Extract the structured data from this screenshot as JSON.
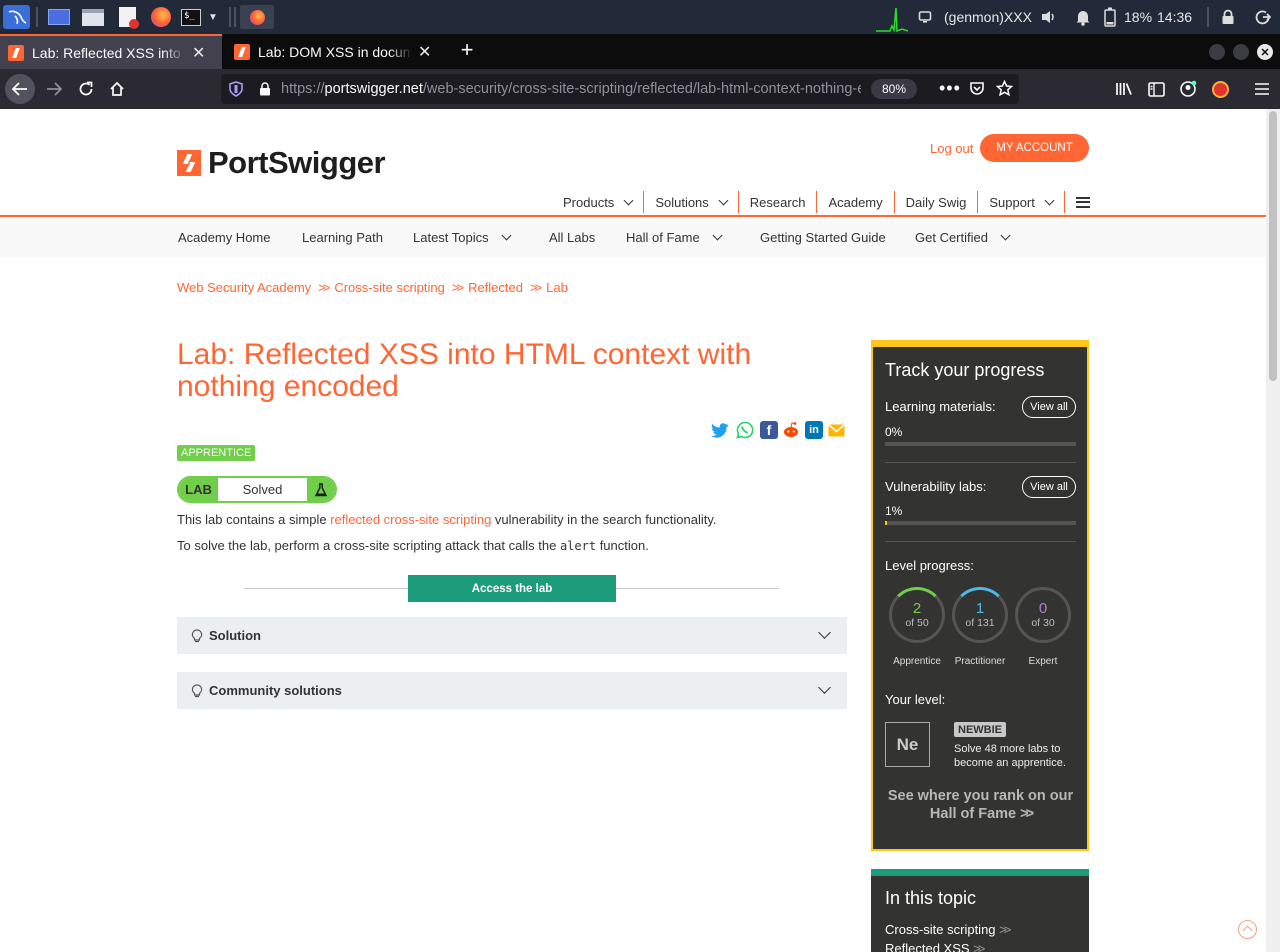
{
  "taskbar": {
    "status_text": "(genmon)XXX",
    "battery": "18%",
    "clock": "14:36"
  },
  "browser": {
    "tabs": [
      {
        "title": "Lab: Reflected XSS into HTML context",
        "active": true
      },
      {
        "title": "Lab: DOM XSS in document.write sink",
        "active": false
      }
    ],
    "url_scheme": "https://",
    "url_host": "portswigger.net",
    "url_path": "/web-security/cross-site-scripting/reflected/lab-html-context-nothing-encoded",
    "zoom": "80%"
  },
  "site": {
    "logo_text": "PortSwigger",
    "logout": "Log out",
    "my_account": "MY ACCOUNT",
    "main_nav": [
      {
        "label": "Products",
        "dropdown": true
      },
      {
        "label": "Solutions",
        "dropdown": true
      },
      {
        "label": "Research",
        "dropdown": false
      },
      {
        "label": "Academy",
        "dropdown": false
      },
      {
        "label": "Daily Swig",
        "dropdown": false
      },
      {
        "label": "Support",
        "dropdown": true
      }
    ],
    "sub_nav": [
      {
        "label": "Academy Home"
      },
      {
        "label": "Learning Path"
      },
      {
        "label": "Latest Topics"
      },
      {
        "label": "All Labs"
      },
      {
        "label": "Hall of Fame"
      },
      {
        "label": "Getting Started Guide"
      },
      {
        "label": "Get Certified"
      }
    ],
    "breadcrumbs": [
      "Web Security Academy",
      "Cross-site scripting",
      "Reflected",
      "Lab"
    ]
  },
  "lab": {
    "title": "Lab: Reflected XSS into HTML context with nothing encoded",
    "level": "APPRENTICE",
    "status_prefix": "LAB",
    "status": "Solved",
    "desc1_before": "This lab contains a simple ",
    "desc1_link": "reflected cross-site scripting",
    "desc1_after": " vulnerability in the search functionality.",
    "desc2_before": "To solve the lab, perform a cross-site scripting attack that calls the ",
    "desc2_code": "alert",
    "desc2_after": " function.",
    "access_button": "Access the lab",
    "accordions": [
      "Solution",
      "Community solutions"
    ]
  },
  "progress": {
    "heading": "Track your progress",
    "learning_label": "Learning materials:",
    "learning_pct": "0%",
    "learning_value": 0,
    "labs_label": "Vulnerability labs:",
    "labs_pct": "1%",
    "labs_value": 1,
    "view_all": "View all",
    "level_label": "Level progress:",
    "levels": [
      {
        "count": "2",
        "of": "of 50",
        "name": "Apprentice",
        "color": "#70ce4a"
      },
      {
        "count": "1",
        "of": "of 131",
        "name": "Practitioner",
        "color": "#4eb8e6"
      },
      {
        "count": "0",
        "of": "of 30",
        "name": "Expert",
        "color": "#b07fd6"
      }
    ],
    "your_level_label": "Your level:",
    "level_symbol": "Ne",
    "level_badge": "NEWBIE",
    "level_hint": "Solve 48 more labs to become an apprentice.",
    "hall_of_fame": "See where you rank on our Hall of Fame"
  },
  "topic": {
    "heading": "In this topic",
    "items": [
      "Cross-site scripting",
      "Reflected XSS"
    ]
  },
  "colors": {
    "brand": "#ff6633",
    "teal": "#1c9c7a",
    "apprentice": "#70ce4a",
    "sidebar_border": "#ffc61a"
  }
}
